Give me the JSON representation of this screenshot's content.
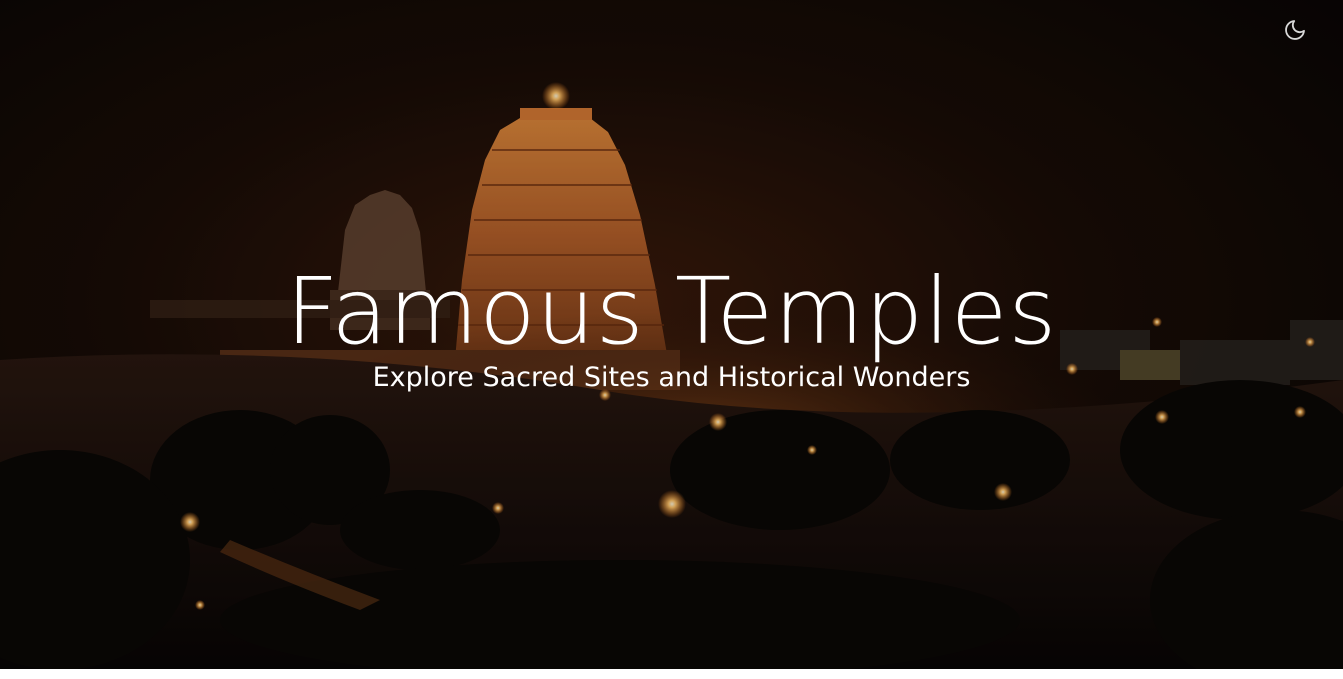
{
  "hero": {
    "title": "Famous Temples",
    "subtitle": "Explore Sacred Sites and Historical Wonders",
    "background_image": "night-temple-town-photo"
  },
  "header": {
    "theme_toggle_icon": "moon-icon"
  },
  "colors": {
    "text": "#ffffff",
    "night_sky": "#0d0806",
    "lamp_glow": "#ffb347",
    "page_background": "#ffffff"
  }
}
